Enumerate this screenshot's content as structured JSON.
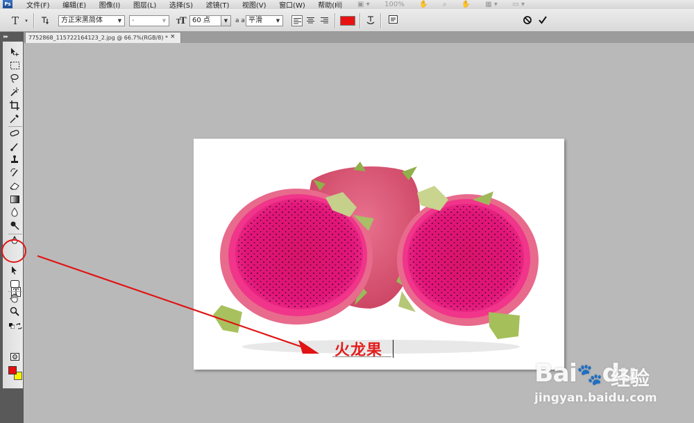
{
  "app": {
    "logo_text": "Ps",
    "menu": [
      "文件(F)",
      "编辑(E)",
      "图像(I)",
      "图层(L)",
      "选择(S)",
      "滤镜(T)",
      "视图(V)",
      "窗口(W)",
      "帮助(H)"
    ],
    "zoom_display": "100%"
  },
  "options_bar": {
    "tool_label": "T",
    "font_family": "方正宋黑简体",
    "font_style": "-",
    "font_size": "60 点",
    "antialias_label": "a a",
    "antialias": "平滑",
    "text_color": "#e81212"
  },
  "document": {
    "tab_title": "7752868_115722164123_2.jpg @ 66.7%(RGB/8) *",
    "tab_close": "×",
    "canvas_text": "火龙果"
  },
  "toolbox": {
    "foreground_color": "#e80d0d",
    "background_color": "#fff200",
    "type_tool_label": "T"
  },
  "annotation": {
    "color": "#e01414"
  },
  "watermark": {
    "logo": "Bai",
    "logo_suffix": "du",
    "brand_text": "经验",
    "url": "jingyan.baidu.com"
  }
}
